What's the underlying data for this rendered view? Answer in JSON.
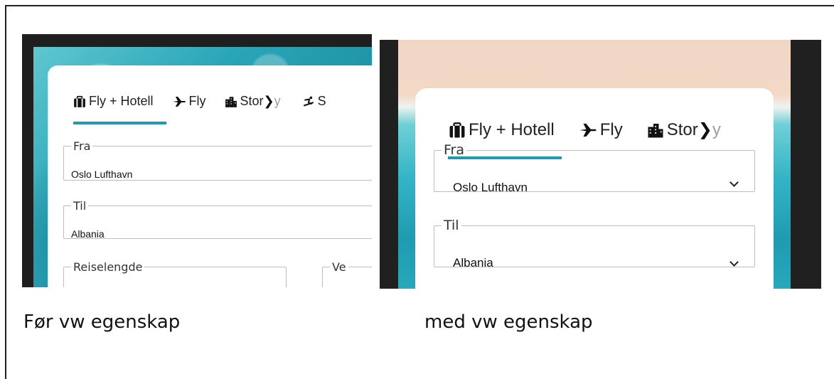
{
  "captions": {
    "left": "Før vw egenskap",
    "right": "med vw egenskap"
  },
  "screenshot_left": {
    "tabs": [
      {
        "label": "Fly + Hotell",
        "icon": "suitcase-icon",
        "active": true
      },
      {
        "label": "Fly",
        "icon": "plane-icon"
      },
      {
        "label_visible": "Stor",
        "label_faded": "y",
        "icon": "city-icon"
      },
      {
        "label": "S",
        "icon": "ski-icon"
      }
    ],
    "fields": {
      "fra": {
        "legend": "Fra",
        "value": "Oslo Lufthavn"
      },
      "til": {
        "legend": "Til",
        "value": "Albania"
      },
      "reiselengde": {
        "legend": "Reiselengde"
      },
      "ve": {
        "legend": "Ve"
      }
    }
  },
  "screenshot_right": {
    "tabs": [
      {
        "label": "Fly + Hotell",
        "icon": "suitcase-icon",
        "active": true
      },
      {
        "label": "Fly",
        "icon": "plane-icon"
      },
      {
        "label_visible": "Stor",
        "label_faded": "y",
        "icon": "city-icon"
      }
    ],
    "fields": {
      "fra": {
        "legend": "Fra",
        "value": "Oslo Lufthavn"
      },
      "til": {
        "legend": "Til",
        "value": "Albania"
      }
    }
  },
  "colors": {
    "accent": "#1e9ab3",
    "frame_dark": "#202020"
  }
}
